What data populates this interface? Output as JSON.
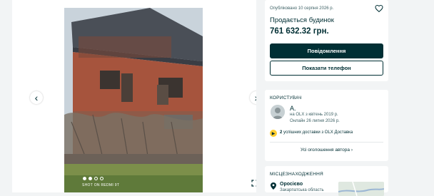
{
  "gallery": {
    "watermark": "SHOT ON REDMI 9T",
    "prev_icon": "chevron-left-icon",
    "next_icon": "chevron-right-icon",
    "expand_icon": "fullscreen-icon",
    "dots": 4
  },
  "listing": {
    "posted": "Опубліковано 10 серпня 2026 р.",
    "title": "Продається будинок",
    "price": "761 632.32 грн.",
    "message_button": "Повідомлення",
    "phone_button": "Показати телефон"
  },
  "user": {
    "section_title": "КОРИСТУВАЧ",
    "name": "А.",
    "since": "на OLX з квітень 2019 р.",
    "online": "Онлайн 26 липня 2026 р.",
    "deliveries_count": "2",
    "deliveries_text": "успішних доставки з OLX Доставка",
    "all_ads": "Усі оголошення автора"
  },
  "location": {
    "section_title": "МІСЦЕЗНАХОДЖЕННЯ",
    "city": "Оросієво",
    "region": "Закарпатська область"
  },
  "colors": {
    "primary": "#002f34",
    "background": "#f2f4f5",
    "delivery_badge": "#ffce32"
  }
}
